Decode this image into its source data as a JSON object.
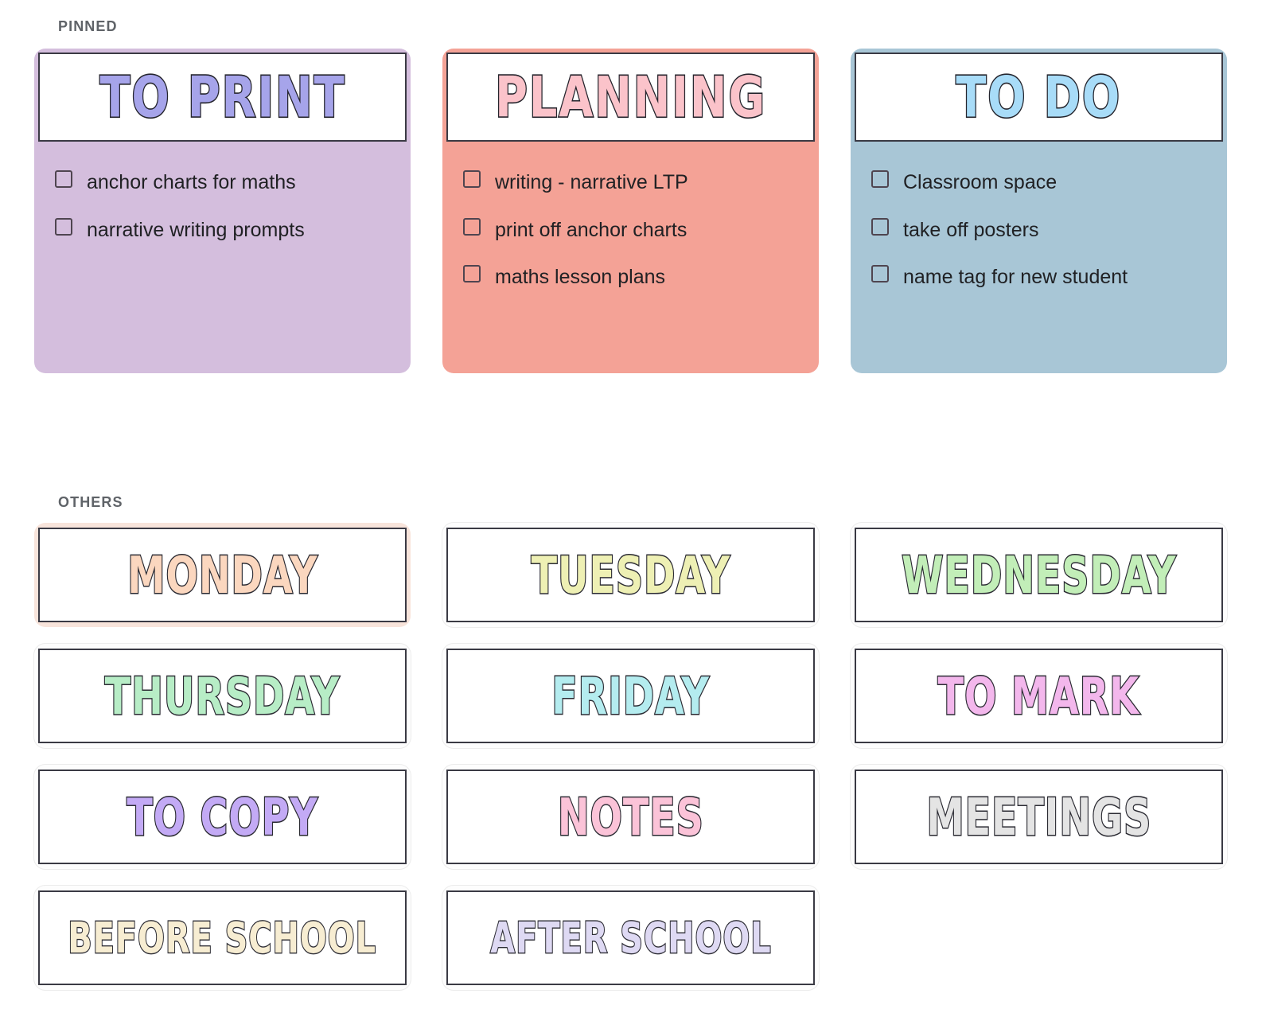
{
  "sections": {
    "pinned_label": "PINNED",
    "others_label": "OTHERS"
  },
  "pinned": [
    {
      "title": "TO PRINT",
      "body_color": "#d4bedd",
      "title_color": "#a6a4ea",
      "items": [
        {
          "label": "anchor charts for maths",
          "checked": false
        },
        {
          "label": "narrative writing prompts",
          "checked": false
        }
      ]
    },
    {
      "title": "PLANNING",
      "body_color": "#f4a296",
      "title_color": "#fbc3ca",
      "items": [
        {
          "label": "writing - narrative LTP",
          "checked": false
        },
        {
          "label": "print off anchor charts",
          "checked": false
        },
        {
          "label": "maths lesson plans",
          "checked": false
        }
      ]
    },
    {
      "title": "TO DO",
      "body_color": "#a8c6d6",
      "title_color": "#a8dcf8",
      "items": [
        {
          "label": "Classroom space",
          "checked": false
        },
        {
          "label": "take off posters",
          "checked": false
        },
        {
          "label": "name tag for new student",
          "checked": false
        }
      ]
    }
  ],
  "others": [
    {
      "title": "MONDAY",
      "title_color": "#fbd7bf",
      "card_color": "#f8e4db"
    },
    {
      "title": "TUESDAY",
      "title_color": "#eef0b4",
      "card_color": "#fdfdfd"
    },
    {
      "title": "WEDNESDAY",
      "title_color": "#c2eeb8",
      "card_color": "#fdfdfd"
    },
    {
      "title": "THURSDAY",
      "title_color": "#b7edc6",
      "card_color": "#fdfdfd"
    },
    {
      "title": "FRIDAY",
      "title_color": "#b4ecef",
      "card_color": "#fdfdfd"
    },
    {
      "title": "TO MARK",
      "title_color": "#f3b7ec",
      "card_color": "#fdfdfd"
    },
    {
      "title": "TO COPY",
      "title_color": "#c3aaf5",
      "card_color": "#fdfdfd"
    },
    {
      "title": "NOTES",
      "title_color": "#fbc3d8",
      "card_color": "#fdfdfd"
    },
    {
      "title": "MEETINGS",
      "title_color": "#e4e4e4",
      "card_color": "#fdfdfd"
    },
    {
      "title": "BEFORE SCHOOL",
      "title_color": "#f7edd2",
      "card_color": "#fdfdfd"
    },
    {
      "title": "AFTER SCHOOL",
      "title_color": "#ded9f3",
      "card_color": "#fdfdfd"
    }
  ]
}
